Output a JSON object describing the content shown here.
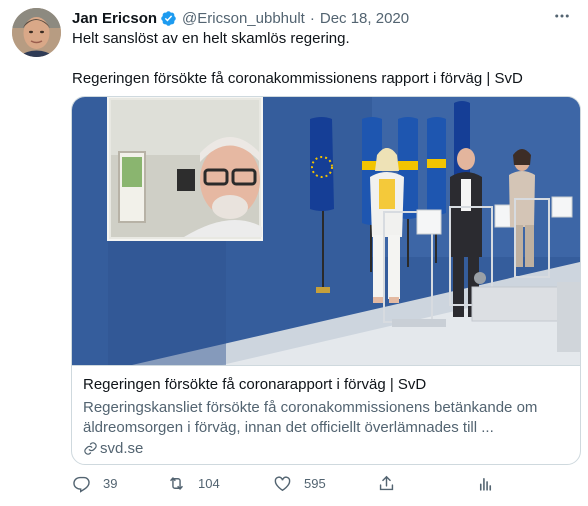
{
  "tweet": {
    "author_name": "Jan Ericson",
    "handle": "@Ericson_ubbhult",
    "separator": "·",
    "date": "Dec 18, 2020",
    "text_line1": "Helt sanslöst av en helt skamlös regering.",
    "text_line2": "Regeringen försökte få coronakommissionens rapport i förväg | SvD"
  },
  "card": {
    "title": "Regeringen försökte få coronarapport i förväg | SvD",
    "description_line1": "Regeringskansliet försökte få coronakommissionens betänkande om",
    "description_line2": "äldreomsorgen i förväg, innan det officiellt överlämnades till ...",
    "domain": "svd.se"
  },
  "actions": {
    "reply_count": "39",
    "retweet_count": "104",
    "like_count": "595"
  },
  "colors": {
    "verified": "#1d9bf0",
    "muted": "#536471",
    "border": "#cfd9de",
    "wall": "#345b99"
  },
  "icons": [
    "verified-badge-icon",
    "more-icon",
    "link-icon",
    "reply-icon",
    "retweet-icon",
    "like-icon",
    "share-icon",
    "analytics-icon"
  ]
}
